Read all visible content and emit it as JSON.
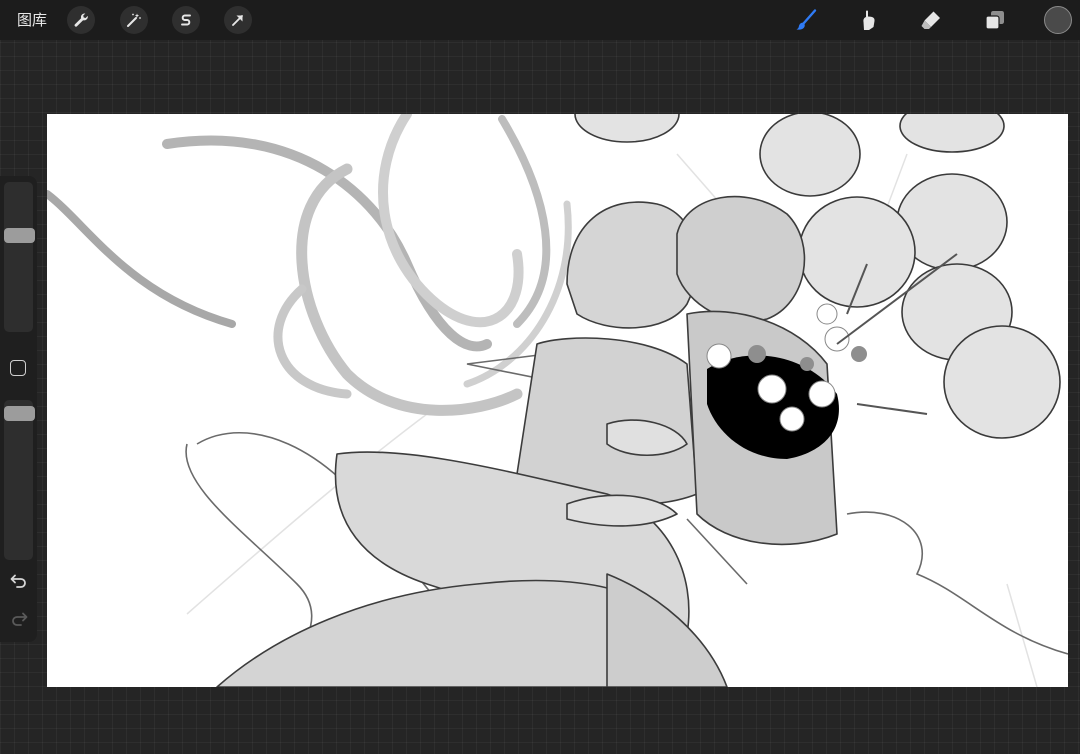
{
  "topbar": {
    "gallery_label": "图库",
    "actions_icon": "wrench-icon",
    "adjustments_icon": "magic-wand-icon",
    "selection_icon": "selection-s-icon",
    "transform_icon": "arrow-cursor-icon",
    "brush_icon": "brush-icon",
    "smudge_icon": "smudge-finger-icon",
    "eraser_icon": "eraser-icon",
    "layers_icon": "layers-icon",
    "current_color": "#4a4a4a",
    "active_tool_color": "#2f7bf5"
  },
  "sidebar": {
    "brush_size_level": 0.2,
    "opacity_level": 0.1,
    "modify_icon": "square-icon",
    "undo_icon": "undo-icon",
    "redo_icon": "redo-icon"
  },
  "canvas": {
    "background": "#ffffff"
  }
}
